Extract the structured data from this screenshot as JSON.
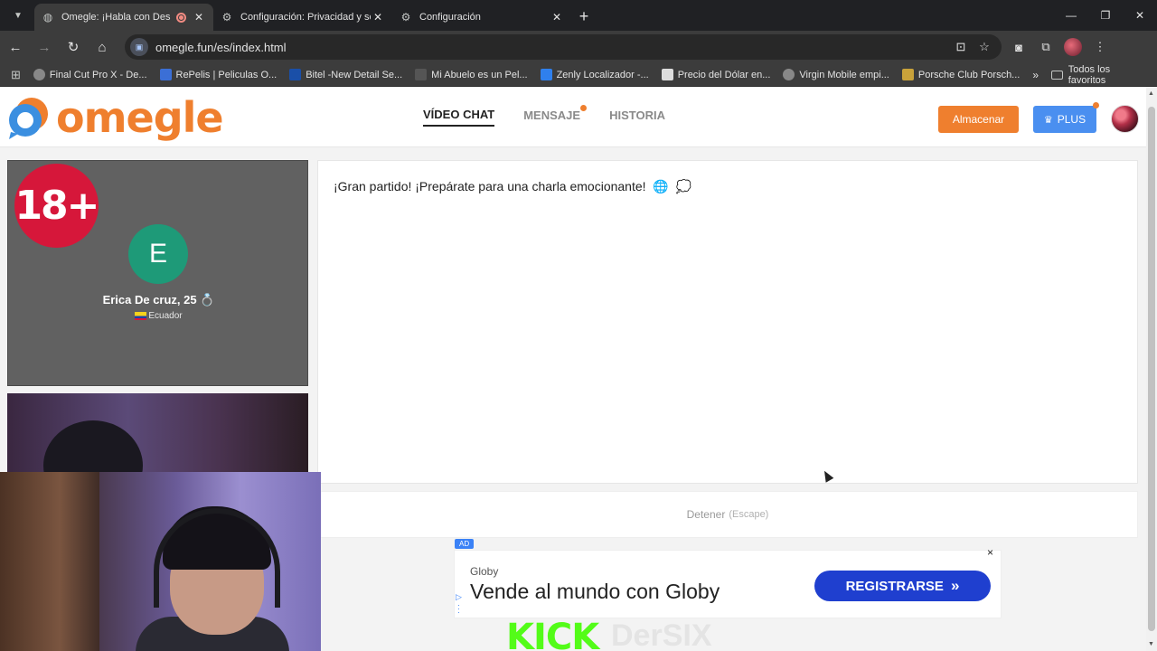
{
  "browser": {
    "tabs": [
      {
        "title": "Omegle: ¡Habla con Descon",
        "active": true
      },
      {
        "title": "Configuración: Privacidad y seg",
        "active": false
      },
      {
        "title": "Configuración",
        "active": false
      }
    ],
    "url": "omegle.fun/es/index.html",
    "bookmarks": [
      {
        "label": "Final Cut Pro X - De...",
        "color": "#888888"
      },
      {
        "label": "RePelis | Peliculas O...",
        "color": "#3b6fd6"
      },
      {
        "label": "Bitel -New Detail Se...",
        "color": "#1a4fa8"
      },
      {
        "label": "Mi Abuelo es un Pel...",
        "color": "#555555"
      },
      {
        "label": "Zenly Localizador -...",
        "color": "#2f80ed"
      },
      {
        "label": "Precio del Dólar en...",
        "color": "#dddddd"
      },
      {
        "label": "Virgin Mobile empi...",
        "color": "#888888"
      },
      {
        "label": "Porsche Club Porsch...",
        "color": "#c9a23a"
      }
    ],
    "bookmarks_all": "Todos los favoritos"
  },
  "site": {
    "logo_text": "omegle",
    "nav": [
      {
        "label": "VÍDEO CHAT",
        "active": true,
        "dot": false
      },
      {
        "label": "MENSAJE",
        "active": false,
        "dot": true
      },
      {
        "label": "HISTORIA",
        "active": false,
        "dot": false
      }
    ],
    "store_label": "Almacenar",
    "plus_label": "PLUS"
  },
  "stranger": {
    "badge": "18+",
    "initial": "E",
    "name": "Erica De cruz, 25",
    "name_icon": "💍",
    "country": "Ecuador"
  },
  "chat": {
    "message": "¡Gran partido! ¡Prepárate para una charla emocionante!",
    "emoji1": "🌐",
    "emoji2": "💭"
  },
  "controls": {
    "stop_label": "Detener",
    "stop_hint": "(Escape)"
  },
  "ad": {
    "tag": "AD",
    "brand": "Globy",
    "headline": "Vende al mundo con Globy",
    "cta": "REGISTRARSE",
    "close": "×"
  },
  "overlay": {
    "kick": "KICK",
    "watermark": "DerSIX"
  },
  "colors": {
    "accent_orange": "#ef7f2e",
    "plus_blue": "#4a8ff0",
    "badge_red": "#d6173a",
    "avatar_green": "#1e9a78",
    "ad_cta": "#1f3fcf",
    "kick_green": "#53fc18"
  }
}
